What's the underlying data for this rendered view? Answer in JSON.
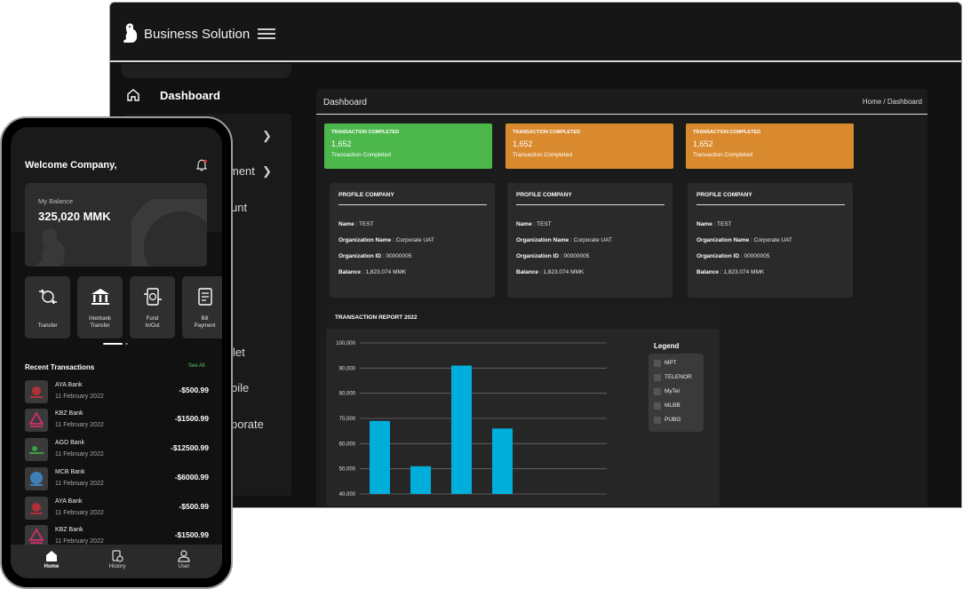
{
  "desktop": {
    "app_title": "Business Solution",
    "sidebar": {
      "dashboard_label": "Dashboard",
      "partial_items": [
        "ment",
        "unt",
        "let",
        "bile",
        "porate"
      ]
    },
    "main": {
      "title": "Dashboard",
      "breadcrumb": "Home  /  Dashboard"
    },
    "stats": [
      {
        "header": "TRANSACTION COMPLETED",
        "value": "1,652",
        "sub": "Transaction Completed",
        "color": "#4cb84c"
      },
      {
        "header": "TRANSACTION COMPLETED",
        "value": "1,652",
        "sub": "Transaction Completed",
        "color": "#d98a2e"
      },
      {
        "header": "TRANSACTION COMPLETED",
        "value": "1,652",
        "sub": "Transaction Completed",
        "color": "#d98a2e"
      }
    ],
    "profiles": [
      {
        "header": "PROFILE COMPANY",
        "name_label": "Name",
        "name": " : TEST",
        "org_label": "Organization Name",
        "org": " : Corporate UAT",
        "id_label": "Organization ID",
        "id": " : 00000005",
        "bal_label": "Balance",
        "bal": " : 1,823.074 MMK"
      },
      {
        "header": "PROFILE COMPANY",
        "name_label": "Name",
        "name": " : TEST",
        "org_label": "Organization Name",
        "org": " : Corporate UAT",
        "id_label": "Organization ID",
        "id": " : 00000005",
        "bal_label": "Balance",
        "bal": " : 1,823.074 MMK"
      },
      {
        "header": "PROFILE COMPANY",
        "name_label": "Name",
        "name": " : TEST",
        "org_label": "Organization Name",
        "org": " : Corporate UAT",
        "id_label": "Organization ID",
        "id": " : 00000005",
        "bal_label": "Balance",
        "bal": " : 1,823.074 MMK"
      }
    ],
    "report": {
      "title": "TRANSACTION REPORT 2022",
      "legend_title": "Legend",
      "legend": [
        "MPT",
        "TELENOR",
        "MyTel",
        "MLBB",
        "PUBG"
      ]
    }
  },
  "chart_data": {
    "type": "bar",
    "title": "TRANSACTION REPORT 2022",
    "categories": [
      "MPT",
      "TELENOR",
      "MyTel",
      "MLBB"
    ],
    "values": [
      69000,
      51000,
      91000,
      66000
    ],
    "ylim": [
      40000,
      100000
    ],
    "yticks": [
      "100,000",
      "90,000",
      "80,000",
      "70,000",
      "60,000",
      "50,000",
      "40,000"
    ],
    "ytick_values": [
      100000,
      90000,
      80000,
      70000,
      60000,
      50000,
      40000
    ],
    "grid": true,
    "legend_placement": "right",
    "bar_color": "#00aedb"
  },
  "phone": {
    "welcome": "Welcome Company,",
    "balance_label": "My Balance",
    "balance_value": "325,020 MMK",
    "actions": [
      {
        "line1": "Transfer",
        "line2": ""
      },
      {
        "line1": "Interbank",
        "line2": "Transfer"
      },
      {
        "line1": "Fund",
        "line2": "In/Out"
      },
      {
        "line1": "Bill",
        "line2": "Payment"
      }
    ],
    "recent_title": "Recent Transactions",
    "see_all": "See All",
    "transactions": [
      {
        "bank": "AYA Bank",
        "date": "11 February 2022",
        "amount": "-$500.99"
      },
      {
        "bank": "KBZ Bank",
        "date": "11 February 2022",
        "amount": "-$1500.99"
      },
      {
        "bank": "AGD Bank",
        "date": "11 February 2022",
        "amount": "-$12500.99"
      },
      {
        "bank": "MCB Bank",
        "date": "11 February 2022",
        "amount": "-$6000.99"
      },
      {
        "bank": "AYA Bank",
        "date": "11 February 2022",
        "amount": "-$500.99"
      },
      {
        "bank": "KBZ Bank",
        "date": "11 February 2022",
        "amount": "-$1500.99"
      }
    ],
    "nav": [
      "Home",
      "History",
      "User"
    ]
  }
}
